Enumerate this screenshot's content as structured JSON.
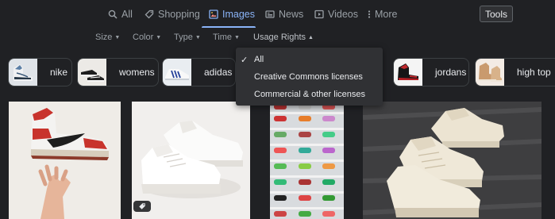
{
  "nav": {
    "tabs": [
      {
        "label": "All",
        "icon": "search-icon",
        "active": false
      },
      {
        "label": "Shopping",
        "icon": "tag-icon",
        "active": false
      },
      {
        "label": "Images",
        "icon": "image-icon",
        "active": true
      },
      {
        "label": "News",
        "icon": "newspaper-icon",
        "active": false
      },
      {
        "label": "Videos",
        "icon": "play-icon",
        "active": false
      },
      {
        "label": "More",
        "icon": "more-vert-icon",
        "active": false
      }
    ],
    "tools_label": "Tools"
  },
  "filters": [
    "Size",
    "Color",
    "Type",
    "Time",
    "Usage Rights"
  ],
  "chips": [
    {
      "label": "nike",
      "thumb": "white-blue high-top sneaker"
    },
    {
      "label": "womens",
      "thumb": "black and white low sneakers"
    },
    {
      "label": "adidas",
      "thumb": "white sneaker with blue stripes"
    },
    {
      "label": "jordans",
      "thumb": "black and red sneaker"
    },
    {
      "label": "high top",
      "thumb": "tan high-top sneaker"
    }
  ],
  "usage_rights_menu": {
    "items": [
      {
        "label": "All",
        "selected": true
      },
      {
        "label": "Creative Commons licenses",
        "selected": false
      },
      {
        "label": "Commercial & other licenses",
        "selected": false
      }
    ]
  },
  "results": [
    {
      "alt": "red and white high-top sneaker held in hand"
    },
    {
      "alt": "pair of white sneakers"
    },
    {
      "alt": "shelves of colorful sneakers"
    },
    {
      "alt": "pair of cream sneakers on gray rug"
    }
  ],
  "colors": {
    "background": "#202124",
    "accent": "#8ab4f8",
    "menu_bg": "#303134",
    "text": "#e8eaed",
    "muted_text": "#9aa0a6"
  }
}
